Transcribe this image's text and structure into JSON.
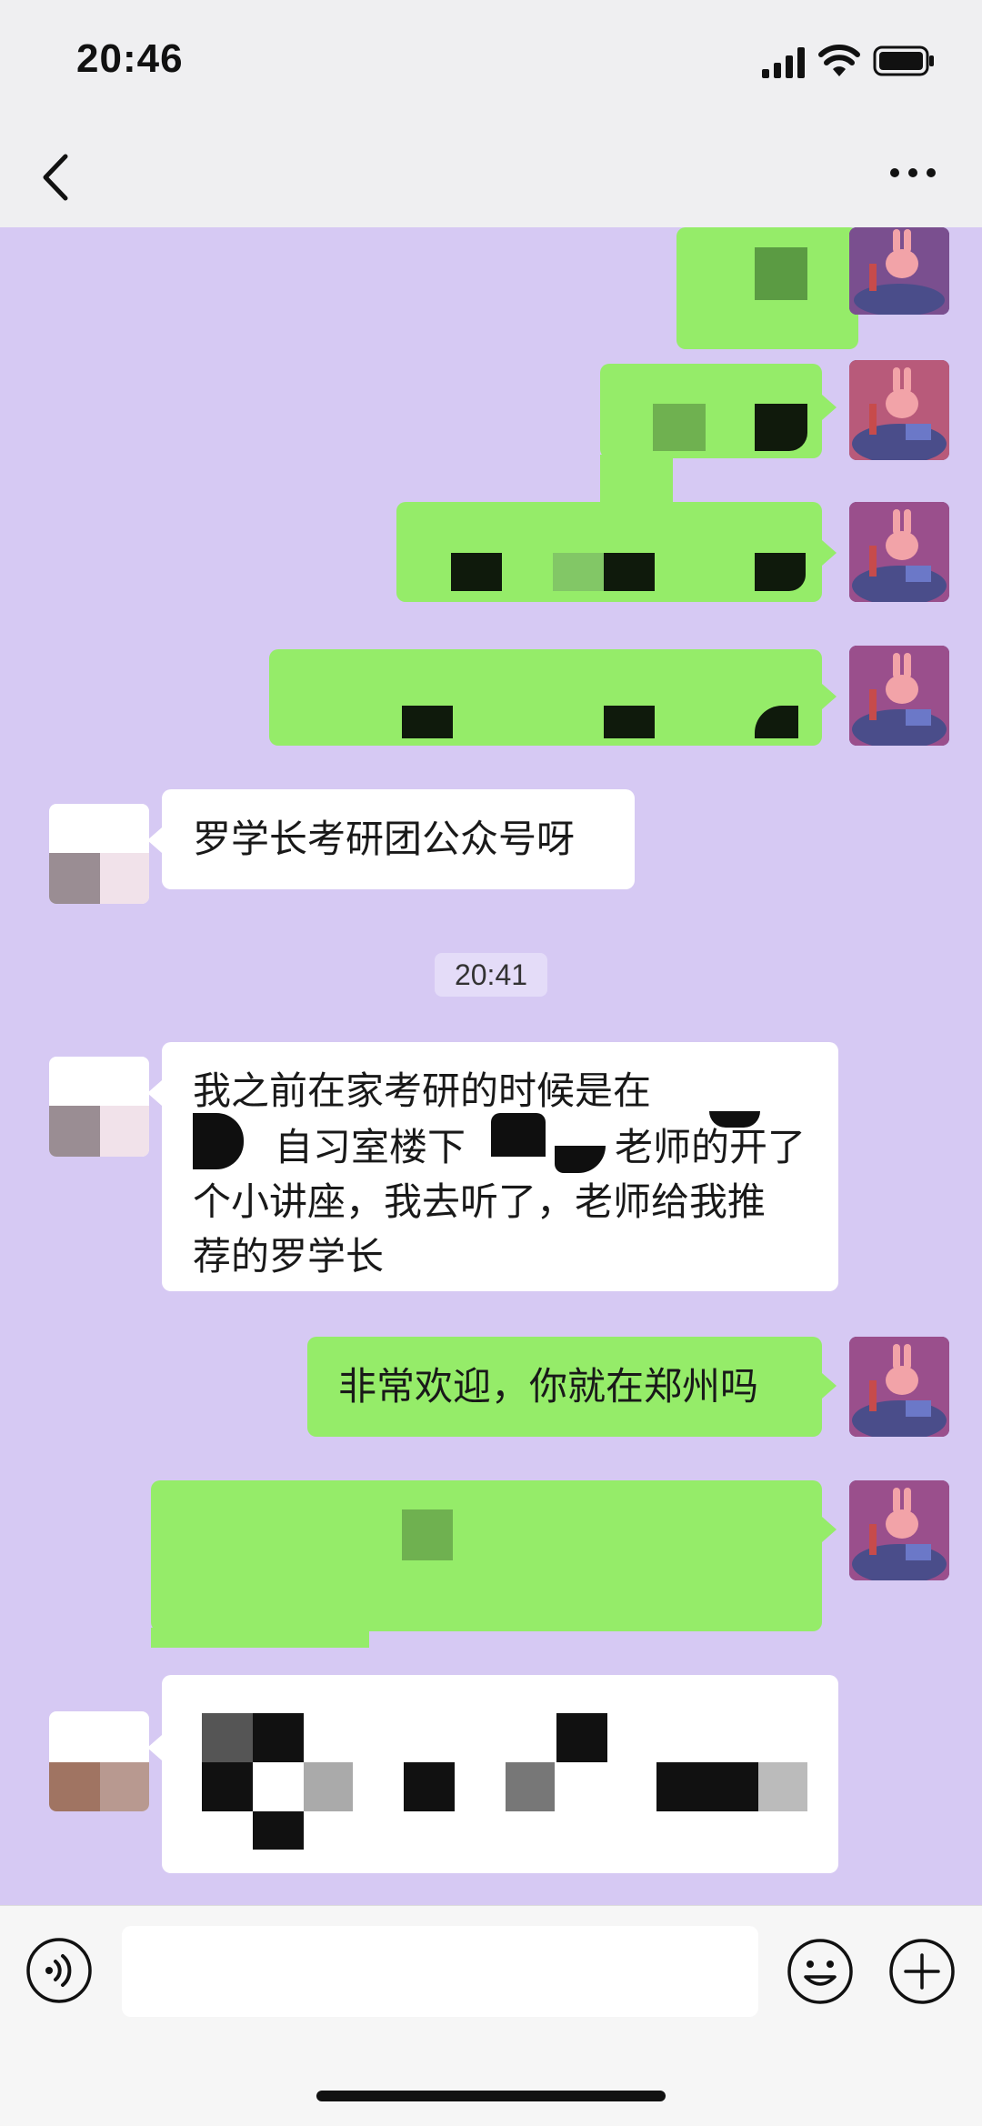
{
  "status_bar": {
    "time": "20:46"
  },
  "header": {
    "back_icon": "chevron-left-icon",
    "more_icon": "ellipsis-icon"
  },
  "chat": {
    "messages": [
      {
        "from": "other",
        "text": "罗学长考研团公众号呀"
      },
      {
        "from": "other",
        "text": "我之前在家考研的时候是在 自习室楼下 老师的开了个小讲座，我去听了，老师给我推荐的罗学长"
      },
      {
        "from": "self",
        "text": "非常欢迎，你就在郑州吗"
      }
    ],
    "timestamp": "20:41",
    "msg1_line1": "罗学长考研团公众号呀",
    "msg2_line1": "我之前在家考研的时候是在",
    "msg2_line2a": "自习室楼下",
    "msg2_line2b": "老师的开了",
    "msg2_line3": "个小讲座，我去听了，老师给我推",
    "msg2_line4": "荐的罗学长",
    "msg3": "非常欢迎，你就在郑州吗"
  },
  "colors": {
    "chat_bg": "#d6c9f3",
    "self_bubble": "#95ec69",
    "other_bubble": "#ffffff",
    "bar_bg": "#efeff1"
  },
  "input_bar": {
    "icons": [
      "voice-icon",
      "emoji-icon",
      "plus-icon"
    ]
  }
}
